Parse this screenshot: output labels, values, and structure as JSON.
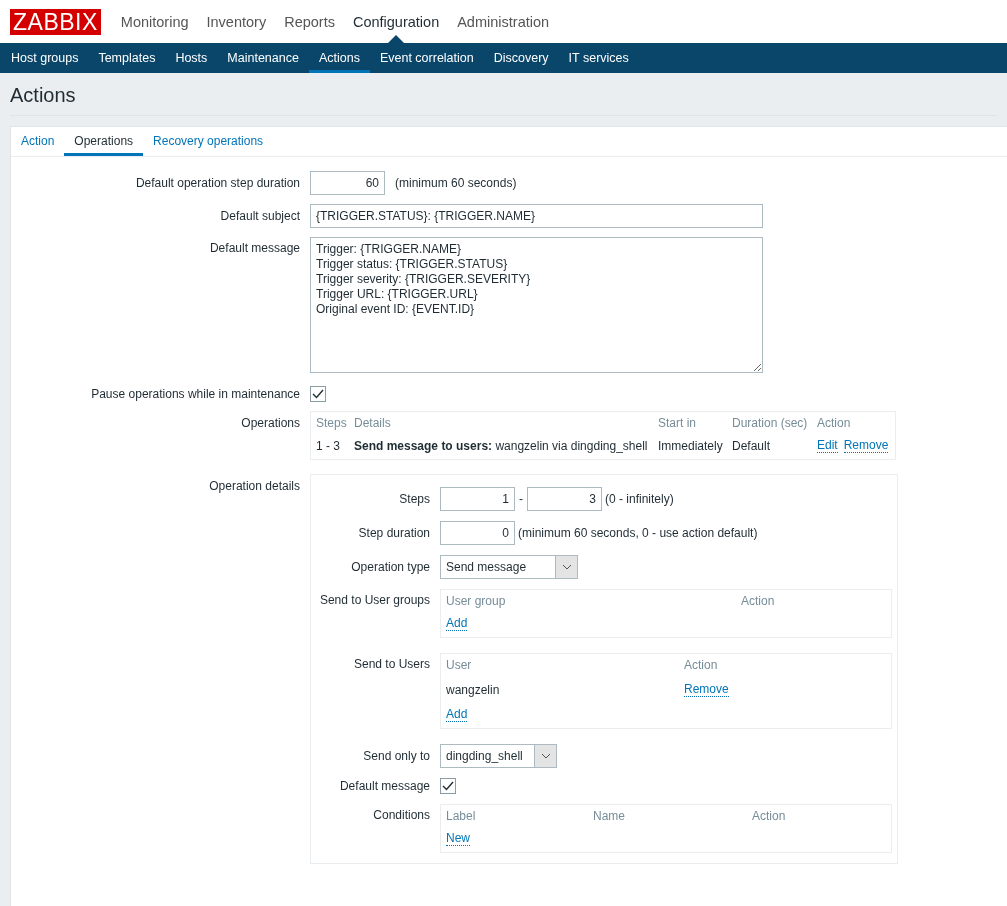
{
  "logo": "ZABBIX",
  "main_menu": [
    {
      "label": "Monitoring",
      "selected": false
    },
    {
      "label": "Inventory",
      "selected": false
    },
    {
      "label": "Reports",
      "selected": false
    },
    {
      "label": "Configuration",
      "selected": true
    },
    {
      "label": "Administration",
      "selected": false
    }
  ],
  "sub_menu": [
    {
      "label": "Host groups",
      "selected": false
    },
    {
      "label": "Templates",
      "selected": false
    },
    {
      "label": "Hosts",
      "selected": false
    },
    {
      "label": "Maintenance",
      "selected": false
    },
    {
      "label": "Actions",
      "selected": true
    },
    {
      "label": "Event correlation",
      "selected": false
    },
    {
      "label": "Discovery",
      "selected": false
    },
    {
      "label": "IT services",
      "selected": false
    }
  ],
  "page_title": "Actions",
  "form_tabs": [
    {
      "label": "Action",
      "selected": false
    },
    {
      "label": "Operations",
      "selected": true
    },
    {
      "label": "Recovery operations",
      "selected": false
    }
  ],
  "step_duration": {
    "label": "Default operation step duration",
    "value": "60",
    "hint": "(minimum 60 seconds)"
  },
  "subject": {
    "label": "Default subject",
    "value": "{TRIGGER.STATUS}: {TRIGGER.NAME}"
  },
  "message": {
    "label": "Default message",
    "value": "Trigger: {TRIGGER.NAME}\nTrigger status: {TRIGGER.STATUS}\nTrigger severity: {TRIGGER.SEVERITY}\nTrigger URL: {TRIGGER.URL}\nOriginal event ID: {EVENT.ID}"
  },
  "pause": {
    "label": "Pause operations while in maintenance",
    "checked": true
  },
  "operations": {
    "label": "Operations",
    "columns": [
      "Steps",
      "Details",
      "Start in",
      "Duration (sec)",
      "Action"
    ],
    "rows": [
      {
        "steps": "1 - 3",
        "details": "**Send message to users:** wangzelin via dingding_shell",
        "start_in": "Immediately",
        "duration": "Default",
        "actions": [
          "Edit",
          "Remove"
        ]
      }
    ]
  },
  "operation_details": {
    "label": "Operation details",
    "steps": {
      "label": "Steps",
      "from": "1",
      "separator": "-",
      "to": "3",
      "hint": "(0 - infinitely)"
    },
    "step_duration": {
      "label": "Step duration",
      "value": "0",
      "hint": "(minimum 60 seconds, 0 - use action default)"
    },
    "operation_type": {
      "label": "Operation type",
      "value": "Send message"
    },
    "user_groups": {
      "label": "Send to User groups",
      "columns": [
        "User group",
        "Action"
      ],
      "link": "Add"
    },
    "users": {
      "label": "Send to Users",
      "columns": [
        "User",
        "Action"
      ],
      "rows": [
        {
          "user": "wangzelin",
          "action": "Remove"
        }
      ],
      "link": "Add"
    },
    "send_only_to": {
      "label": "Send only to",
      "value": "dingding_shell"
    },
    "default_message": {
      "label": "Default message",
      "checked": true
    },
    "conditions": {
      "label": "Conditions",
      "columns": [
        "Label",
        "Name",
        "Action"
      ],
      "link": "New"
    }
  }
}
